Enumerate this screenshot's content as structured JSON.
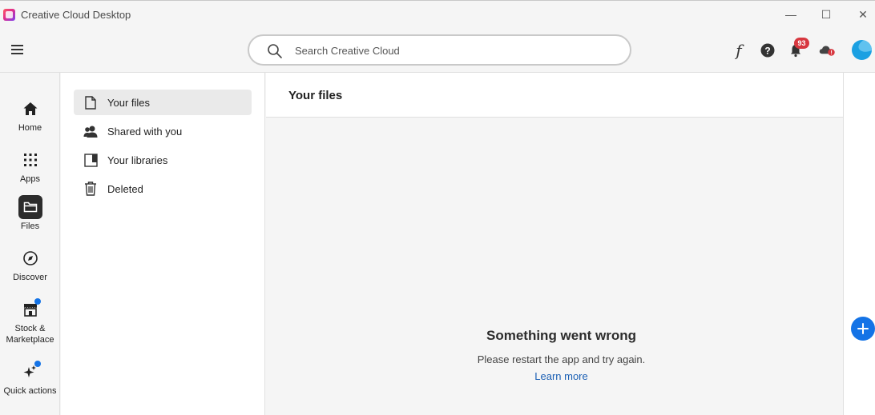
{
  "window": {
    "title": "Creative Cloud Desktop",
    "controls": {
      "minimize": "—",
      "maximize": "☐",
      "close": "✕"
    }
  },
  "header": {
    "search": {
      "placeholder": "Search Creative Cloud",
      "value": ""
    },
    "fonts_glyph": "f",
    "notifications_count": "93",
    "icons": [
      "menu-icon",
      "search-icon",
      "fonts-icon",
      "help-icon",
      "bell-icon",
      "cloud-sync-icon",
      "avatar"
    ]
  },
  "leftnav": {
    "items": [
      {
        "label": "Home",
        "icon": "home-icon"
      },
      {
        "label": "Apps",
        "icon": "apps-grid-icon"
      },
      {
        "label": "Files",
        "icon": "folder-icon",
        "active": true
      },
      {
        "label": "Discover",
        "icon": "compass-icon"
      },
      {
        "label": "Stock &",
        "label2": "Marketplace",
        "icon": "store-icon"
      },
      {
        "label": "Quick actions",
        "icon": "sparkle-icon"
      }
    ]
  },
  "files_panel": {
    "items": [
      {
        "label": "Your files",
        "icon": "file-icon",
        "active": true
      },
      {
        "label": "Shared with you",
        "icon": "people-icon"
      },
      {
        "label": "Your libraries",
        "icon": "library-icon"
      },
      {
        "label": "Deleted",
        "icon": "trash-icon"
      }
    ]
  },
  "main": {
    "title": "Your files",
    "error": {
      "title": "Something went wrong",
      "message": "Please restart the app and try again.",
      "link": "Learn more"
    }
  },
  "colors": {
    "accent": "#1473e6",
    "badge": "#d7373f",
    "link": "#1a5fb4"
  }
}
